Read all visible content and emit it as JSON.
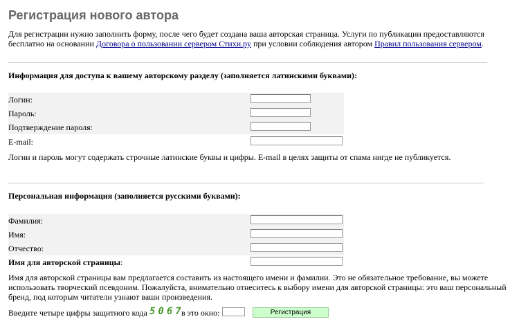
{
  "page": {
    "title": "Регистрация нового автора"
  },
  "intro": {
    "text_before_link1": "Для регистрации нужно заполнить форму, после чего будет создана ваша авторская страница. Услуги по публикации предоставляются бесплатно на основании ",
    "link1": "Договора о пользовании сервером Стихи.ру",
    "text_between": " при условии соблюдения автором ",
    "link2": "Правил пользования сервером",
    "text_after": "."
  },
  "access_section": {
    "heading": "Информация для доступа к вашему авторскому разделу (заполняется латинскими буквами):",
    "fields": [
      {
        "label": "Логин:",
        "value": ""
      },
      {
        "label": "Пароль:",
        "value": ""
      },
      {
        "label": "Подтверждение пароля:",
        "value": ""
      },
      {
        "label": "E-mail:",
        "value": ""
      }
    ],
    "note": "Логин и пароль могут содержать строчные латинские буквы и цифры. E-mail в целях защиты от спама нигде не публикуется."
  },
  "personal_section": {
    "heading": "Персональная информация (заполняется русскими буквами):",
    "fields": [
      {
        "label": "Фамилия:",
        "value": ""
      },
      {
        "label": "Имя:",
        "value": ""
      },
      {
        "label": "Отчество:",
        "value": ""
      }
    ],
    "author_name_label": "Имя для авторской страницы",
    "author_name_colon": ":",
    "note": "Имя для авторской страницы вам предлагается составить из настоящего имени и фамилии. Это не обязательное требование, вы можете использовать творческий псевдоним. Пожалуйста, внимательно отнеситесь к выбору имени для авторской страницы: это ваш персональный бренд, под которым читатели узнают ваши произведения."
  },
  "captcha": {
    "prompt_before": "Введите четыре цифры защитного кода",
    "code": "5067",
    "prompt_after": "в это окно:",
    "value": ""
  },
  "submit": {
    "label": "Регистрация",
    "color": "#ccffcc"
  },
  "colors": {
    "title": "#666666",
    "link": "#00008b",
    "row_background": "#f2f2f2",
    "captcha_code": "#4b9a2f"
  }
}
